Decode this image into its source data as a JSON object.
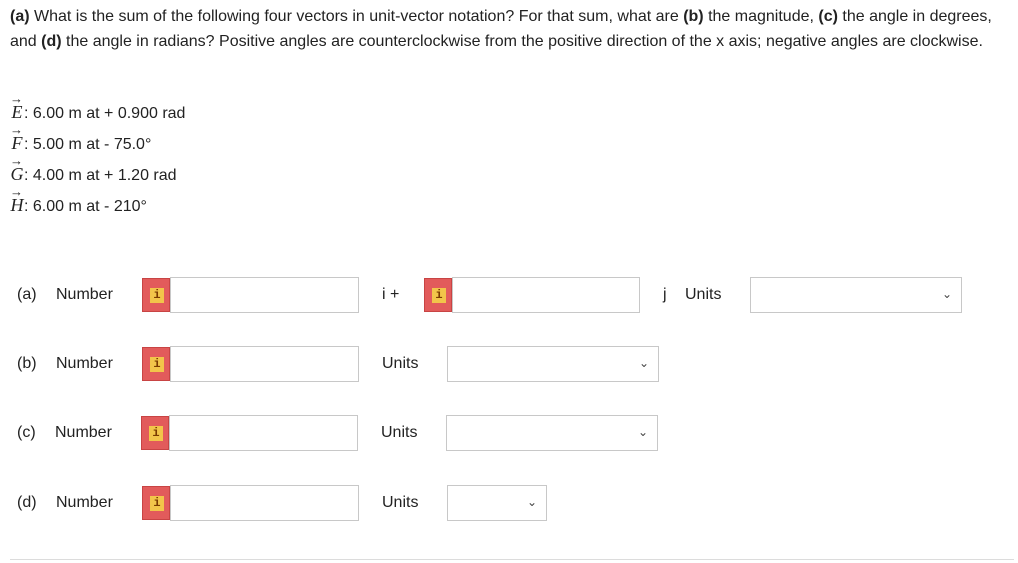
{
  "question": {
    "part_a_label": "(a)",
    "part_a_text": " What is the sum of the following four vectors in unit-vector notation? For that sum, what are ",
    "part_b_label": "(b)",
    "part_b_text": " the magnitude, ",
    "part_c_label": "(c)",
    "part_c_text": " the angle in degrees, and ",
    "part_d_label": "(d)",
    "part_d_text": " the angle in radians? Positive angles are counterclockwise from the positive direction of the x axis; negative angles are clockwise."
  },
  "vectors": [
    {
      "symbol": "E",
      "arrow": "→",
      "text": ": 6.00 m at + 0.900 rad"
    },
    {
      "symbol": "F",
      "arrow": "→",
      "text": ": 5.00 m at - 75.0°"
    },
    {
      "symbol": "G",
      "arrow": "→",
      "text": ": 4.00 m at + 1.20 rad"
    },
    {
      "symbol": "H",
      "arrow": "→",
      "text": ": 6.00 m at - 210°"
    }
  ],
  "answers": {
    "a": {
      "label": "(a)",
      "number": "Number",
      "i_text": "i +",
      "j_text": "j",
      "units": "Units",
      "value1": "",
      "value2": "",
      "unit_value": ""
    },
    "b": {
      "label": "(b)",
      "number": "Number",
      "units": "Units",
      "value": "",
      "unit_value": ""
    },
    "c": {
      "label": "(c)",
      "number": "Number",
      "units": "Units",
      "value": "",
      "unit_value": ""
    },
    "d": {
      "label": "(d)",
      "number": "Number",
      "units": "Units",
      "value": "",
      "unit_value": ""
    }
  },
  "info_glyph": "i",
  "chevron": "⌄",
  "colors": {
    "info_bg": "#e25b5b",
    "info_inner": "#f2c54a",
    "border": "#c8c8c8"
  },
  "icons": {
    "info": "info-icon",
    "dropdown": "chevron-down-icon"
  }
}
